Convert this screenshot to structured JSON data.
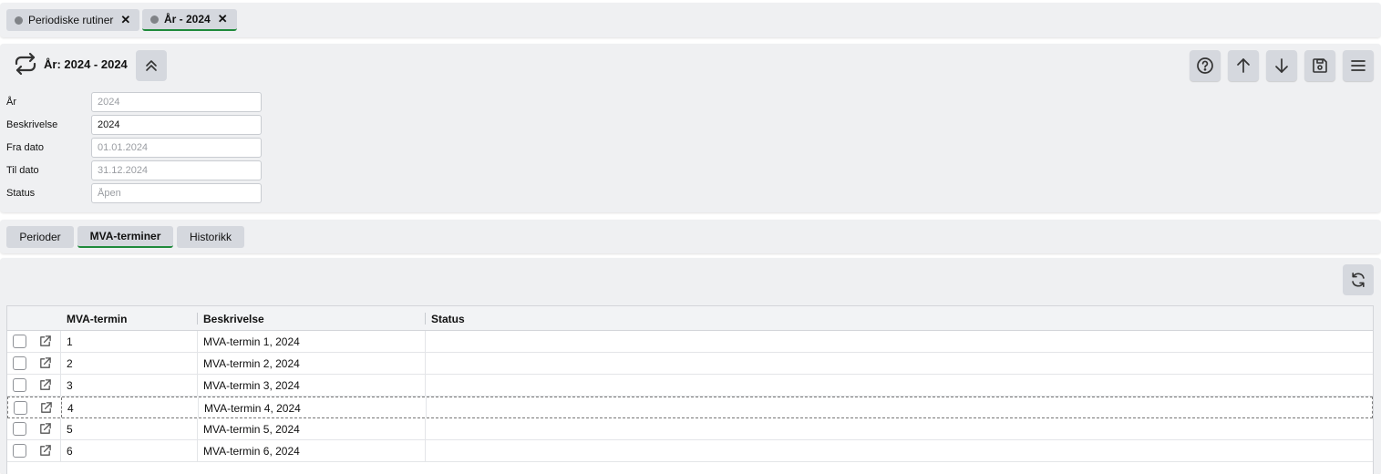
{
  "doc_tabs": [
    {
      "label": "Periodiske rutiner",
      "close": "✕"
    },
    {
      "label": "År - 2024",
      "close": "✕"
    }
  ],
  "header": {
    "title": "År: 2024 - 2024",
    "icon": "cycle-arrows-icon",
    "toolbar_icons": [
      "help-icon",
      "arrow-up-icon",
      "arrow-down-icon",
      "save-icon",
      "menu-icon"
    ]
  },
  "form": {
    "fields": [
      {
        "label": "År",
        "value": "2024"
      },
      {
        "label": "Beskrivelse",
        "value": "2024"
      },
      {
        "label": "Fra dato",
        "value": "01.01.2024"
      },
      {
        "label": "Til dato",
        "value": "31.12.2024"
      },
      {
        "label": "Status",
        "value": "Åpen"
      }
    ]
  },
  "sub_tabs": [
    {
      "label": "Perioder"
    },
    {
      "label": "MVA-terminer"
    },
    {
      "label": "Historikk"
    }
  ],
  "grid": {
    "columns": [
      "MVA-termin",
      "Beskrivelse",
      "Status"
    ],
    "rows": [
      {
        "termin": "1",
        "beskrivelse": "MVA-termin 1, 2024",
        "status": ""
      },
      {
        "termin": "2",
        "beskrivelse": "MVA-termin 2, 2024",
        "status": ""
      },
      {
        "termin": "3",
        "beskrivelse": "MVA-termin 3, 2024",
        "status": ""
      },
      {
        "termin": "4",
        "beskrivelse": "MVA-termin 4, 2024",
        "status": ""
      },
      {
        "termin": "5",
        "beskrivelse": "MVA-termin 5, 2024",
        "status": ""
      },
      {
        "termin": "6",
        "beskrivelse": "MVA-termin 6, 2024",
        "status": ""
      }
    ]
  },
  "colors": {
    "accent": "#1f8a3b",
    "button_bg": "#d5d8de",
    "panel_bg": "#eff0f2"
  }
}
